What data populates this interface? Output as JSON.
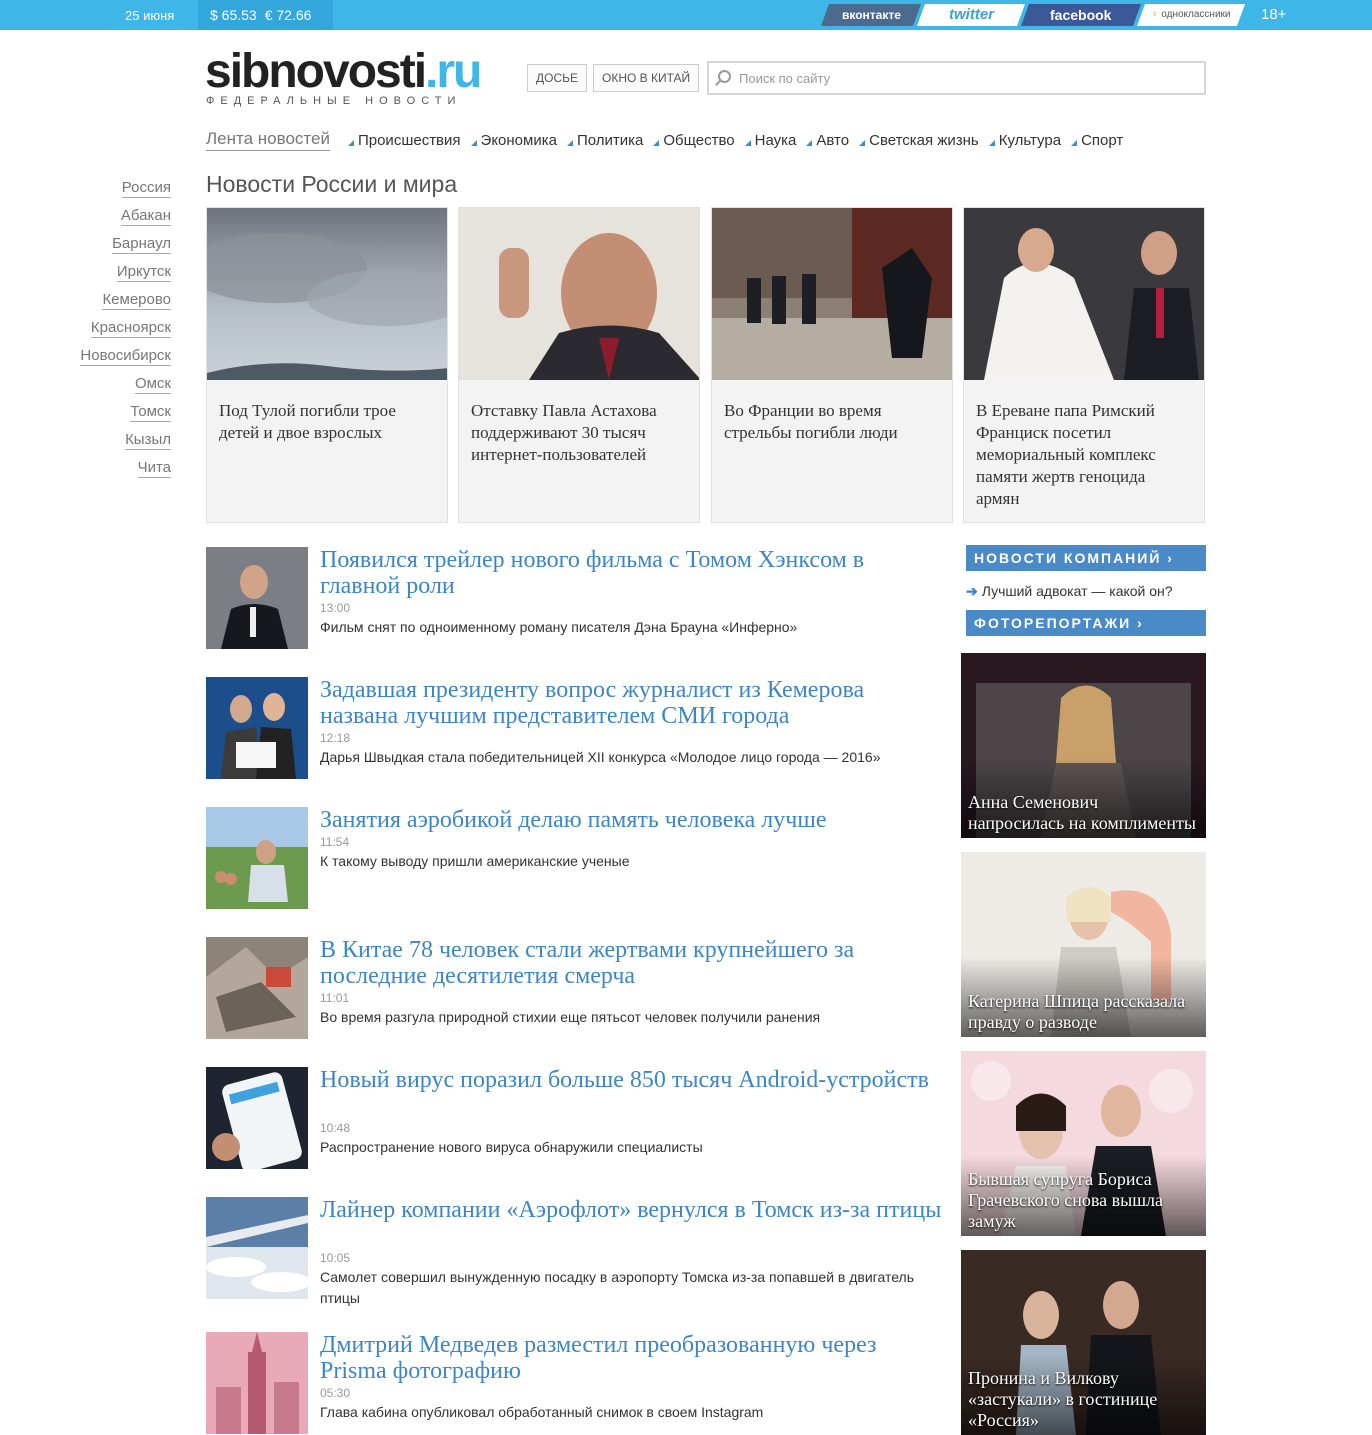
{
  "topbar": {
    "date": "25 июня",
    "usd": "$ 65.53",
    "eur": "€ 72.66",
    "social": {
      "vk": "вконтакте",
      "twitter": "twitter",
      "facebook": "facebook",
      "ok": "одноклассники"
    },
    "age": "18+"
  },
  "header": {
    "logo_main": "sibnovosti",
    "logo_suffix": ".ru",
    "tagline": "ФЕДЕРАЛЬНЫЕ НОВОСТИ",
    "btn_dossier": "ДОСЬЕ",
    "btn_china": "ОКНО В КИТАЙ",
    "search_placeholder": "Поиск по сайту"
  },
  "nav": {
    "lenta": "Лента новостей",
    "items": [
      "Происшествия",
      "Экономика",
      "Политика",
      "Общество",
      "Наука",
      "Авто",
      "Светская жизнь",
      "Культура",
      "Спорт"
    ]
  },
  "cities": [
    "Россия",
    "Абакан",
    "Барнаул",
    "Иркутск",
    "Кемерово",
    "Красноярск",
    "Новосибирск",
    "Омск",
    "Томск",
    "Кызыл",
    "Чита"
  ],
  "section_title": "Новости России и мира",
  "top_cards": [
    {
      "caption": "Под Тулой погибли трое детей и двое взрослых"
    },
    {
      "caption": "Отставку Павла Астахова поддерживают 30 тысяч интернет-пользователей"
    },
    {
      "caption": "Во Франции во время стрельбы погибли люди"
    },
    {
      "caption": "В Ереване папа Римский Франциск посетил мемориальный комплекс памяти жертв геноцида армян"
    }
  ],
  "news": [
    {
      "title": "Появился трейлер нового фильма с Томом Хэнксом в главной роли",
      "time": "13:00",
      "desc": "Фильм снят по одноименному роману писателя Дэна Брауна «Инферно»"
    },
    {
      "title": "Задавшая президенту вопрос журналист из Кемерова названа лучшим представителем СМИ города",
      "time": "12:18",
      "desc": "Дарья Швыдкая стала победительницей XII конкурса «Молодое лицо города — 2016»"
    },
    {
      "title": "Занятия аэробикой делаю память человека лучше",
      "time": "11:54",
      "desc": "К такому выводу пришли американские ученые"
    },
    {
      "title": "В Китае 78 человек стали жертвами крупнейшего за последние десятилетия смерча",
      "time": "11:01",
      "desc": "Во время разгула природной стихии еще пятьсот человек получили ранения"
    },
    {
      "title": "Новый вирус поразил больше 850 тысяч Android-устройств",
      "time": "10:48",
      "desc": "Распространение нового вируса обнаружили специалисты"
    },
    {
      "title": "Лайнер компании «Аэрофлот» вернулся в Томск из-за птицы",
      "time": "10:05",
      "desc": "Самолет совершил вынужденную посадку в аэропорту Томска из-за попавшей в двигатель птицы"
    },
    {
      "title": "Дмитрий Медведев разместил преобразованную через Prisma фотографию",
      "time": "05:30",
      "desc": "Глава кабина опубликовал обработанный снимок в своем Instagram"
    }
  ],
  "right": {
    "companies_header": "НОВОСТИ КОМПАНИЙ ›",
    "companies_link": "Лучший адвокат — какой он?",
    "photo_header": "ФОТОРЕПОРТАЖИ ›",
    "photos": [
      {
        "title": "Анна Семенович напросилась на комплименты"
      },
      {
        "title": "Катерина Шпица рассказала правду о разводе"
      },
      {
        "title": "Бывшая супруга Бориса Грачевского снова вышла замуж"
      },
      {
        "title": "Пронина и Вилкову «застукали» в гостинице «Россия»"
      }
    ]
  }
}
